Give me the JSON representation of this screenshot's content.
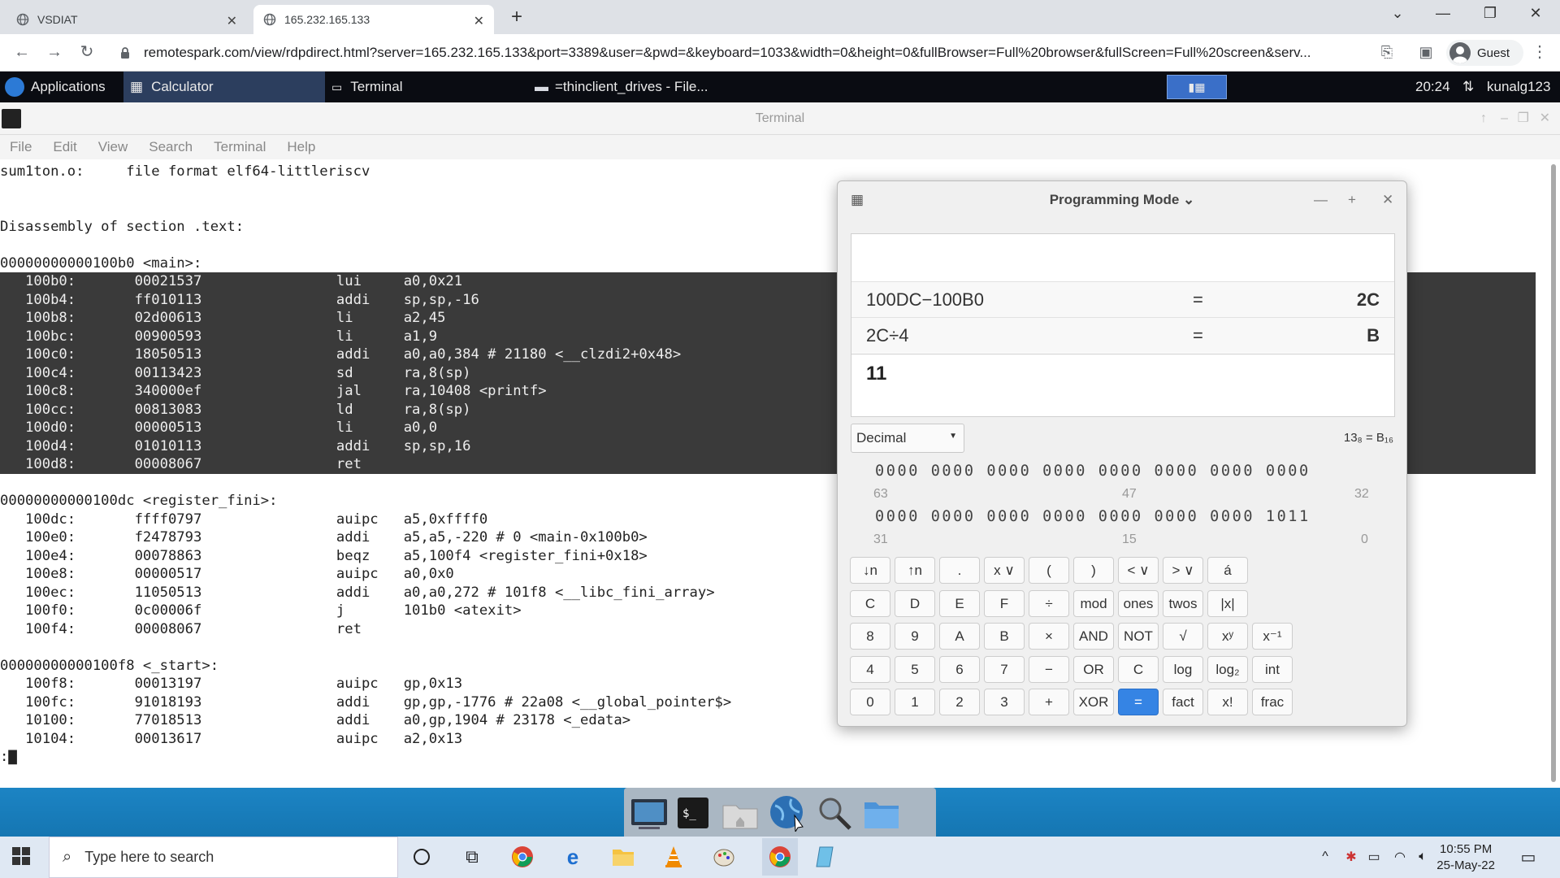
{
  "browser": {
    "tabs": [
      {
        "title": "VSDIAT",
        "active": false
      },
      {
        "title": "165.232.165.133",
        "active": true
      }
    ],
    "new_tab": "+",
    "url": "remotespark.com/view/rdpdirect.html?server=165.232.165.133&port=3389&user=&pwd=&keyboard=1033&width=0&height=0&fullBrowser=Full%20browser&fullScreen=Full%20screen&serv...",
    "profile": "Guest"
  },
  "panel": {
    "applications": "Applications",
    "tasks": [
      "Calculator",
      "Terminal",
      "=thinclient_drives - File..."
    ],
    "time": "20:24",
    "user": "kunalg123"
  },
  "terminal": {
    "title": "Terminal",
    "menu": [
      "File",
      "Edit",
      "View",
      "Search",
      "Terminal",
      "Help"
    ],
    "lines": [
      {
        "text": "sum1ton.o:     file format elf64-littleriscv",
        "hl": false
      },
      {
        "text": "",
        "hl": false
      },
      {
        "text": "",
        "hl": false
      },
      {
        "text": "Disassembly of section .text:",
        "hl": false
      },
      {
        "text": "",
        "hl": false
      },
      {
        "text": "00000000000100b0 <main>:",
        "hl": false
      },
      {
        "text": "   100b0:       00021537                lui     a0,0x21",
        "hl": true
      },
      {
        "text": "   100b4:       ff010113                addi    sp,sp,-16",
        "hl": true
      },
      {
        "text": "   100b8:       02d00613                li      a2,45",
        "hl": true
      },
      {
        "text": "   100bc:       00900593                li      a1,9",
        "hl": true
      },
      {
        "text": "   100c0:       18050513                addi    a0,a0,384 # 21180 <__clzdi2+0x48>",
        "hl": true
      },
      {
        "text": "   100c4:       00113423                sd      ra,8(sp)",
        "hl": true
      },
      {
        "text": "   100c8:       340000ef                jal     ra,10408 <printf>",
        "hl": true
      },
      {
        "text": "   100cc:       00813083                ld      ra,8(sp)",
        "hl": true
      },
      {
        "text": "   100d0:       00000513                li      a0,0",
        "hl": true
      },
      {
        "text": "   100d4:       01010113                addi    sp,sp,16",
        "hl": true
      },
      {
        "text": "   100d8:       00008067                ret",
        "hl": true
      },
      {
        "text": "",
        "hl": false
      },
      {
        "text": "00000000000100dc <register_fini>:",
        "hl": false
      },
      {
        "text": "   100dc:       ffff0797                auipc   a5,0xffff0",
        "hl": false
      },
      {
        "text": "   100e0:       f2478793                addi    a5,a5,-220 # 0 <main-0x100b0>",
        "hl": false
      },
      {
        "text": "   100e4:       00078863                beqz    a5,100f4 <register_fini+0x18>",
        "hl": false
      },
      {
        "text": "   100e8:       00000517                auipc   a0,0x0",
        "hl": false
      },
      {
        "text": "   100ec:       11050513                addi    a0,a0,272 # 101f8 <__libc_fini_array>",
        "hl": false
      },
      {
        "text": "   100f0:       0c00006f                j       101b0 <atexit>",
        "hl": false
      },
      {
        "text": "   100f4:       00008067                ret",
        "hl": false
      },
      {
        "text": "",
        "hl": false
      },
      {
        "text": "00000000000100f8 <_start>:",
        "hl": false
      },
      {
        "text": "   100f8:       00013197                auipc   gp,0x13",
        "hl": false
      },
      {
        "text": "   100fc:       91018193                addi    gp,gp,-1776 # 22a08 <__global_pointer$>",
        "hl": false
      },
      {
        "text": "   10100:       77018513                addi    a0,gp,1904 # 23178 <_edata>",
        "hl": false
      },
      {
        "text": "   10104:       00013617                auipc   a2,0x13",
        "hl": false
      },
      {
        "text": ":▇",
        "hl": false
      }
    ]
  },
  "calculator": {
    "mode": "Programming Mode",
    "history": [
      {
        "expr": "100DC−100B0",
        "eq": "=",
        "result": "2C"
      },
      {
        "expr": "2C÷4",
        "eq": "=",
        "result": "B"
      }
    ],
    "input": "11",
    "base": "Decimal",
    "base_note": "13₈ = B₁₆",
    "bits_high": "0000 0000 0000 0000 0000 0000 0000 0000",
    "bits_low": "0000 0000 0000 0000 0000 0000 0000 1011",
    "pos_high": [
      "63",
      "47",
      "32"
    ],
    "pos_low": [
      "31",
      "15",
      "0"
    ],
    "buttons": [
      [
        "↓n",
        "↑n",
        ".",
        "x ∨",
        "(",
        ")",
        "< ∨",
        "> ∨",
        "á"
      ],
      [
        "C",
        "D",
        "E",
        "F",
        "÷",
        "mod",
        "ones",
        "twos",
        "|x|"
      ],
      [
        "8",
        "9",
        "A",
        "B",
        "×",
        "AND",
        "NOT",
        "√",
        "xʸ",
        "x⁻¹"
      ],
      [
        "4",
        "5",
        "6",
        "7",
        "−",
        "OR",
        "C",
        "log",
        "log₂",
        "int"
      ],
      [
        "0",
        "1",
        "2",
        "3",
        "+",
        "XOR",
        "=",
        "fact",
        "x!",
        "frac"
      ]
    ]
  },
  "taskbar": {
    "search_placeholder": "Type here to search",
    "time": "10:55 PM",
    "date": "25-May-22"
  },
  "colors": {
    "accent": "#3584e4",
    "panel": "#0a0c12",
    "desktop": "#1b80bf"
  }
}
